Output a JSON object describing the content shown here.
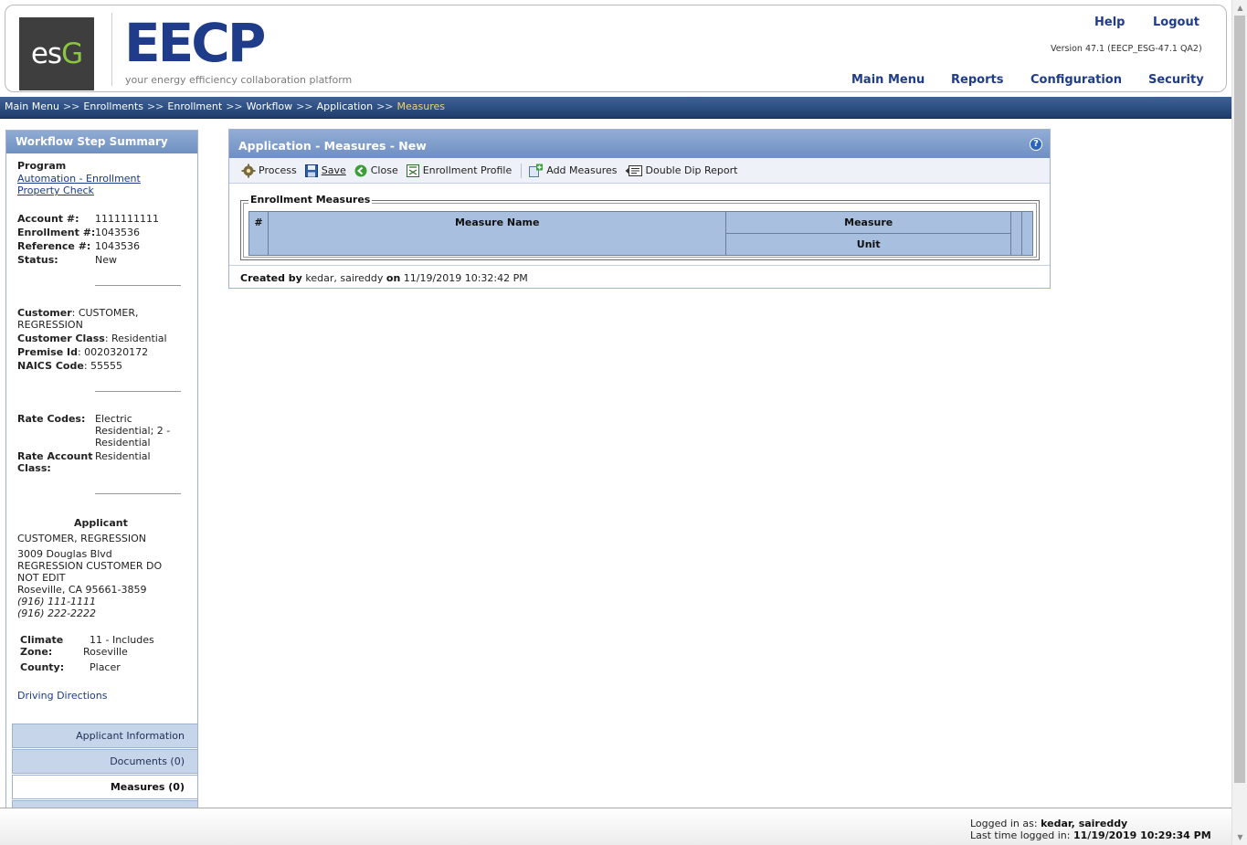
{
  "header": {
    "esg_logo_left": "es",
    "esg_logo_right": "G",
    "eecp_logo_main": "EEC",
    "eecp_logo_end": "P",
    "tagline": "your energy efficiency collaboration platform",
    "help": "Help",
    "logout": "Logout",
    "version": "Version 47.1 (EECP_ESG-47.1 QA2)",
    "nav": [
      "Main Menu",
      "Reports",
      "Configuration",
      "Security"
    ]
  },
  "breadcrumb": {
    "items": [
      "Main Menu",
      "Enrollments",
      "Enrollment",
      "Workflow",
      "Application"
    ],
    "separator": ">>",
    "current": "Measures"
  },
  "sidebar": {
    "title": "Workflow Step Summary",
    "program_label": "Program",
    "program_link1": "Automation - Enrollment",
    "program_link2": "Property Check",
    "account_label": "Account #:",
    "account_value": "1111111111",
    "enrollment_label": "Enrollment #:",
    "enrollment_value": "1043536",
    "reference_label": "Reference #:",
    "reference_value": "1043536",
    "status_label": "Status:",
    "status_value": "New",
    "customer_label": "Customer",
    "customer_value1": ": CUSTOMER,",
    "customer_value2": "REGRESSION",
    "customer_class_label": "Customer Class",
    "customer_class_value": ": Residential",
    "premise_label": "Premise Id",
    "premise_value": ": 0020320172",
    "naics_label": "NAICS Code",
    "naics_value": ": 55555",
    "rate_codes_label": "Rate Codes:",
    "rate_codes_value1": "Electric",
    "rate_codes_value2": "Residential; 2 -",
    "rate_codes_value3": "Residential",
    "rate_account_label1": "Rate Account",
    "rate_account_label2": "Class:",
    "rate_account_value": "Residential",
    "applicant_title": "Applicant",
    "applicant_name": "CUSTOMER, REGRESSION",
    "address1": "3009 Douglas Blvd",
    "address2": "REGRESSION CUSTOMER DO",
    "address3": "NOT EDIT",
    "address4": "Roseville, CA 95661-3859",
    "phone1": "(916) 111-1111",
    "phone2": "(916) 222-2222",
    "climate_label1": "Climate",
    "climate_label2": "Zone:",
    "climate_value1": "11 - Includes",
    "climate_value2": "Roseville",
    "county_label": "County:",
    "county_value": "Placer",
    "driving_directions": "Driving Directions",
    "tabs": {
      "applicant_information": "Applicant Information",
      "documents": "Documents (0)",
      "measures": "Measures (0)"
    }
  },
  "panel": {
    "title": "Application - Measures - New",
    "help_icon": "?",
    "toolbar": {
      "process": "Process",
      "save": "Save",
      "close": "Close",
      "enrollment_profile": "Enrollment Profile",
      "add_measures": "Add Measures",
      "double_dip_report": "Double Dip Report"
    },
    "fieldset_legend": "Enrollment Measures",
    "table_headers": {
      "num": "#",
      "measure_name": "Measure Name",
      "measure": "Measure",
      "unit": "Unit"
    },
    "created_by_label": "Created by",
    "created_by_value": "kedar, saireddy",
    "created_on_label": "on",
    "created_on_value": "11/19/2019 10:32:42 PM"
  },
  "footer": {
    "logged_in_label": "Logged in as:",
    "logged_in_value": "kedar, saireddy",
    "last_time_label": "Last time logged in:",
    "last_time_value": "11/19/2019 10:29:34 PM"
  },
  "icons": {
    "process": "gear-icon",
    "save": "floppy-icon",
    "close": "back-arrow-icon",
    "enrollment_profile": "profile-icon",
    "add_measures": "add-icon",
    "double_dip_report": "report-icon"
  }
}
